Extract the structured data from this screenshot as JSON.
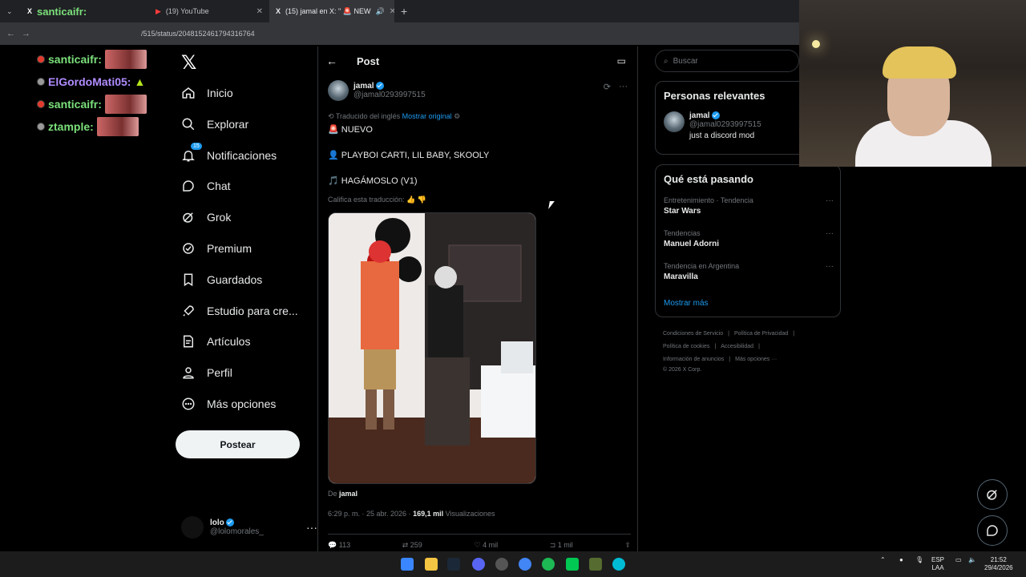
{
  "browser": {
    "tabs": [
      {
        "label": "santicaifr:",
        "active": false
      },
      {
        "label": "(19) YouTube",
        "active": false
      },
      {
        "label": "(15) jamal en X: \" 🚨 NEW",
        "active": true
      }
    ],
    "url": "/515/status/2048152461794316764"
  },
  "chat": [
    {
      "user": "santicaifr:",
      "color": "#7be07b",
      "dot": "#e23b2e"
    },
    {
      "user": "ElGordoMati05:",
      "color": "#b08cff",
      "dot": "#9a9a9a"
    },
    {
      "user": "santicaifr:",
      "color": "#7be07b",
      "dot": "#e23b2e"
    },
    {
      "user": "ztample:",
      "color": "#7be07b",
      "dot": "#9a9a9a"
    }
  ],
  "nav": {
    "items": [
      {
        "label": "Inicio",
        "icon": "home-icon"
      },
      {
        "label": "Explorar",
        "icon": "search-icon"
      },
      {
        "label": "Notificaciones",
        "icon": "bell-icon",
        "badge": "15"
      },
      {
        "label": "Chat",
        "icon": "chat-icon"
      },
      {
        "label": "Grok",
        "icon": "grok-icon"
      },
      {
        "label": "Premium",
        "icon": "premium-icon"
      },
      {
        "label": "Guardados",
        "icon": "bookmark-icon"
      },
      {
        "label": "Estudio para cre...",
        "icon": "rocket-icon"
      },
      {
        "label": "Artículos",
        "icon": "article-icon"
      },
      {
        "label": "Perfil",
        "icon": "person-icon"
      },
      {
        "label": "Más opciones",
        "icon": "more-icon"
      }
    ],
    "post_button": "Postear",
    "account": {
      "name": "lolo",
      "handle": "@lolomorales_"
    }
  },
  "post": {
    "header_title": "Post",
    "author_name": "jamal",
    "author_handle": "@jamal0293997515",
    "translated_label": "Traducido del inglés",
    "show_original": "Mostrar original",
    "lines": [
      "🚨 NUEVO",
      "👤 PLAYBOI CARTI, LIL BABY, SKOOLY",
      "🎵 HAGÁMOSLO (V1)"
    ],
    "rate_translation": "Califica esta traducción:",
    "from_label": "De",
    "from_name": "jamal",
    "timestamp": "6:29 p. m. · 25 abr. 2026 ·",
    "views_count": "169,1 mil",
    "views_label": "Visualizaciones",
    "stats": {
      "replies": "113",
      "reposts": "259",
      "likes": "4 mil",
      "bookmarks": "1 mil"
    }
  },
  "sidebar": {
    "search_placeholder": "Buscar",
    "relevant_title": "Personas relevantes",
    "relevant_name": "jamal",
    "relevant_handle": "@jamal0293997515",
    "relevant_bio": "just a discord mod",
    "trends_title": "Qué está pasando",
    "trends": [
      {
        "category": "Entretenimiento · Tendencia",
        "name": "Star Wars"
      },
      {
        "category": "Tendencias",
        "name": "Manuel Adorni"
      },
      {
        "category": "Tendencia en Argentina",
        "name": "Maravilla"
      }
    ],
    "show_more": "Mostrar más",
    "footer": [
      "Condiciones de Servicio",
      "Política de Privacidad",
      "Política de cookies",
      "Accesibilidad",
      "Información de anuncios",
      "Más opciones ···",
      "© 2026 X Corp."
    ]
  },
  "taskbar": {
    "lang": "ESP",
    "lang2": "LAA",
    "time": "21:52",
    "date": "29/4/2026"
  }
}
